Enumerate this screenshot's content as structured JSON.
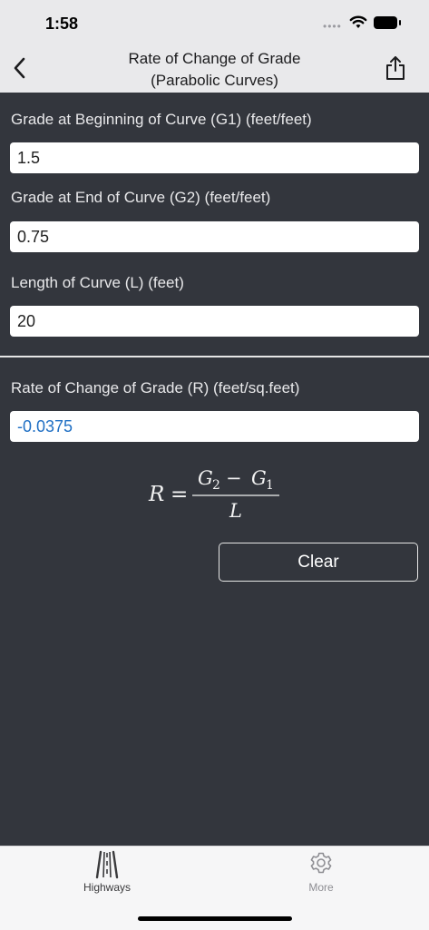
{
  "status_bar": {
    "time": "1:58",
    "signal_icon": "signal-dots-icon",
    "wifi_icon": "wifi-icon",
    "battery_icon": "battery-icon"
  },
  "nav": {
    "title_line1": "Rate of Change of Grade",
    "title_line2": "(Parabolic Curves)",
    "back_icon": "chevron-left-icon",
    "share_icon": "share-icon"
  },
  "inputs": [
    {
      "label": "Grade at Beginning of Curve (G1) (feet/feet)",
      "value": "1.5"
    },
    {
      "label": "Grade at End of Curve (G2) (feet/feet)",
      "value": "0.75"
    },
    {
      "label": "Length of Curve (L) (feet)",
      "value": "20"
    }
  ],
  "result": {
    "label": "Rate of Change of Grade (R) (feet/sq.feet)",
    "value": "-0.0375"
  },
  "formula": {
    "lhs": "R",
    "equals": "=",
    "numerator_a": "G",
    "numerator_a_sub": "2",
    "minus": "−",
    "numerator_b": "G",
    "numerator_b_sub": "1",
    "denominator": "L"
  },
  "clear_button": {
    "label": "Clear"
  },
  "tabs": [
    {
      "label": "Highways",
      "icon": "road-icon"
    },
    {
      "label": "More",
      "icon": "gear-icon"
    }
  ],
  "colors": {
    "background": "#33363d",
    "bar": "#e9e9eb",
    "result_text": "#1f6fc4"
  }
}
